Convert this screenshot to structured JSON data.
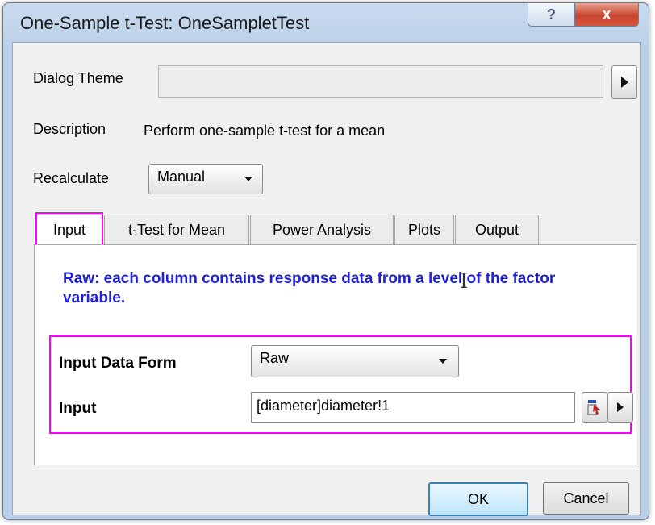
{
  "window": {
    "title": "One-Sample t-Test: OneSampletTest"
  },
  "caption_buttons": {
    "help": "?",
    "close": "x"
  },
  "dialog_theme": {
    "label": "Dialog Theme",
    "value": ""
  },
  "description": {
    "label": "Description",
    "value": "Perform one-sample t-test for a mean"
  },
  "recalculate": {
    "label": "Recalculate",
    "selected": "Manual"
  },
  "tabs": [
    {
      "label": "Input",
      "active": true
    },
    {
      "label": "t-Test for Mean",
      "active": false
    },
    {
      "label": "Power Analysis",
      "active": false
    },
    {
      "label": "Plots",
      "active": false
    },
    {
      "label": "Output",
      "active": false
    }
  ],
  "input_tab": {
    "hint": "Raw: each column contains response data from a level of the factor variable.",
    "data_form": {
      "label": "Input Data Form",
      "selected": "Raw"
    },
    "input": {
      "label": "Input",
      "value": "[diameter]diameter!1"
    }
  },
  "buttons": {
    "ok": "OK",
    "cancel": "Cancel"
  },
  "colors": {
    "highlight": "#ff00ff",
    "hint_text": "#1e1ee0",
    "title_bar": "#b9cfe7",
    "close_button": "#c8452f"
  },
  "icons": [
    "help-icon",
    "close-icon",
    "expand-arrow-icon",
    "dropdown-arrow-icon",
    "column-select-icon",
    "text-cursor-icon"
  ]
}
